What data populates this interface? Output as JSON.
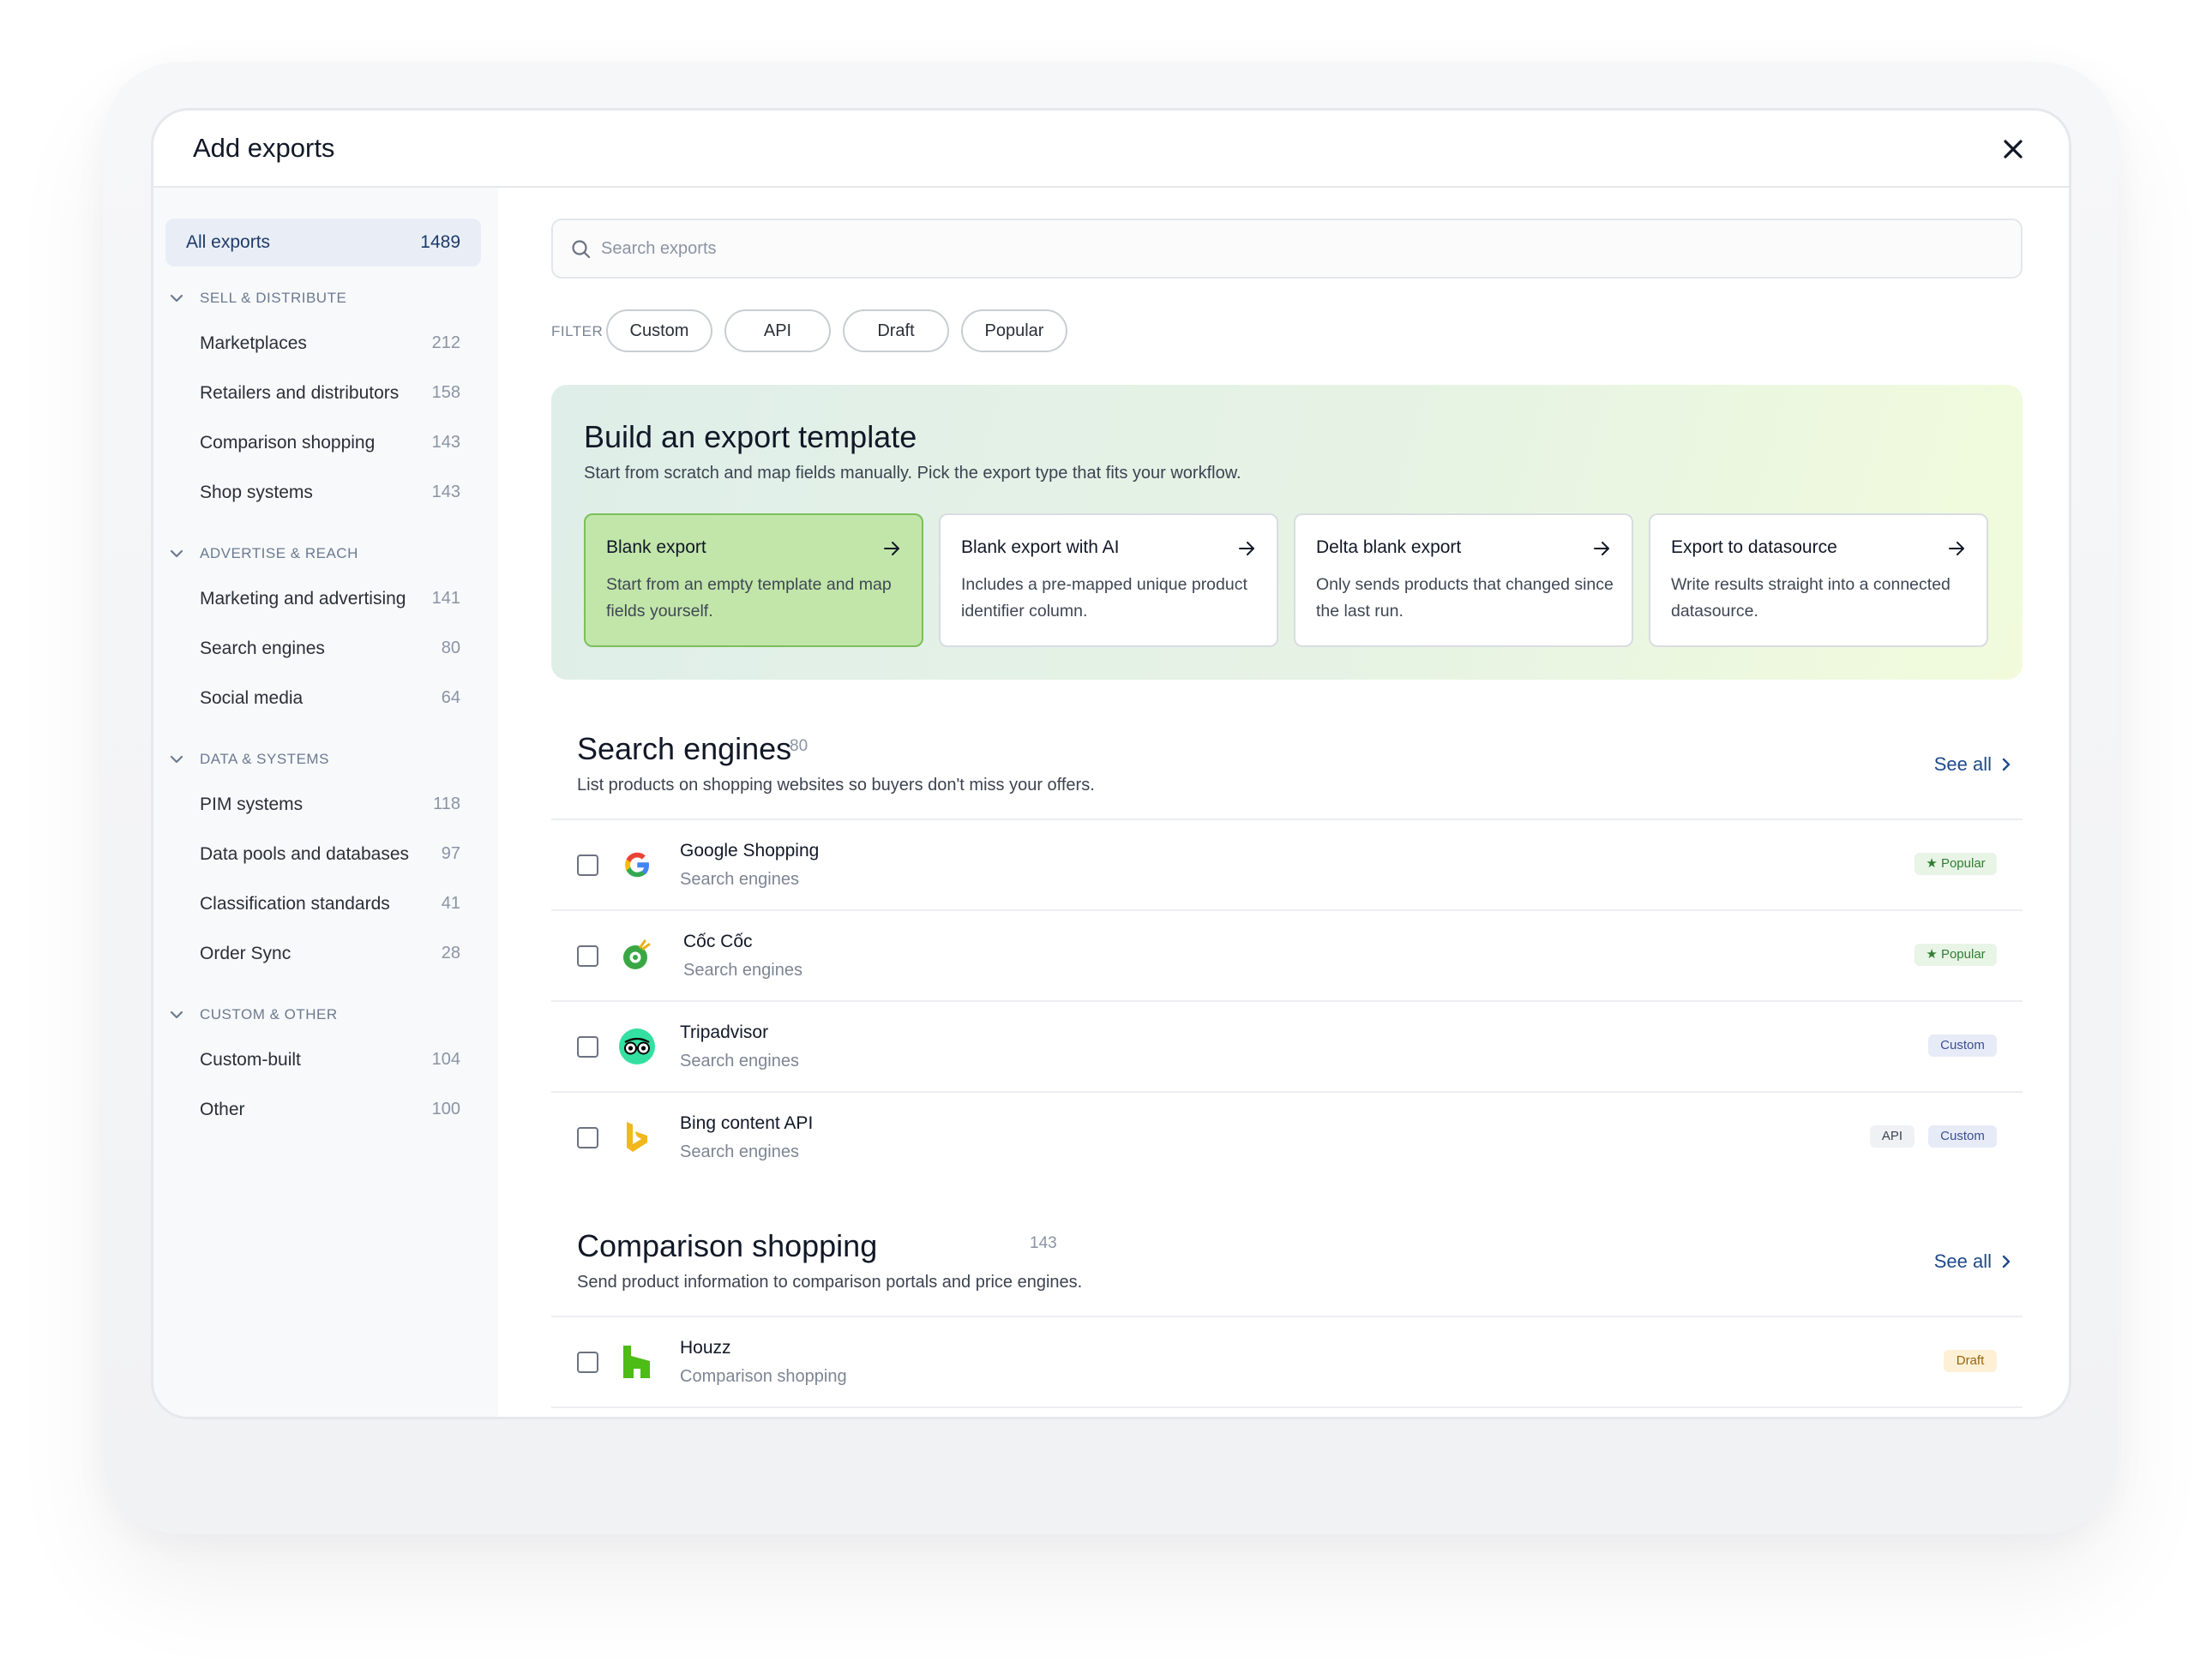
{
  "modal": {
    "title": "Add exports"
  },
  "sidebar": {
    "all": {
      "label": "All exports",
      "count": "1489"
    },
    "groups": [
      {
        "title": "SELL & DISTRIBUTE",
        "items": [
          {
            "label": "Marketplaces",
            "count": "212"
          },
          {
            "label": "Retailers and distributors",
            "count": "158"
          },
          {
            "label": "Comparison shopping",
            "count": "143"
          },
          {
            "label": "Shop systems",
            "count": "143"
          }
        ]
      },
      {
        "title": "ADVERTISE & REACH",
        "items": [
          {
            "label": "Marketing and advertising",
            "count": "141"
          },
          {
            "label": "Search engines",
            "count": "80"
          },
          {
            "label": "Social media",
            "count": "64"
          }
        ]
      },
      {
        "title": "DATA & SYSTEMS",
        "items": [
          {
            "label": "PIM systems",
            "count": "118"
          },
          {
            "label": "Data pools and databases",
            "count": "97"
          },
          {
            "label": "Classification standards",
            "count": "41"
          },
          {
            "label": "Order Sync",
            "count": "28"
          }
        ]
      },
      {
        "title": "CUSTOM & OTHER",
        "items": [
          {
            "label": "Custom-built",
            "count": "104"
          },
          {
            "label": "Other",
            "count": "100"
          }
        ]
      }
    ]
  },
  "search": {
    "placeholder": "Search exports",
    "icon": "search-icon"
  },
  "filters": {
    "label": "FILTER BY",
    "chips": [
      "Custom",
      "API",
      "Draft",
      "Popular"
    ]
  },
  "template": {
    "title": "Build an export template",
    "subtitle": "Start from scratch and map fields manually. Pick the export type that fits your workflow.",
    "cards": [
      {
        "title": "Blank export",
        "desc": "Start from an empty template and map fields yourself."
      },
      {
        "title": "Blank export with AI",
        "desc": "Includes a pre-mapped unique product identifier column."
      },
      {
        "title": "Delta blank export",
        "desc": "Only sends products that changed since the last run."
      },
      {
        "title": "Export to datasource",
        "desc": "Write results straight into a connected datasource."
      }
    ]
  },
  "sections": [
    {
      "title": "Search engines",
      "count": "80",
      "subtitle": "List products on shopping websites so buyers don't miss your offers.",
      "see_all": "See all",
      "rows": [
        {
          "name": "Google Shopping",
          "category": "Search engines",
          "logo": "google-logo",
          "badges": [
            "Popular"
          ]
        },
        {
          "name": "Cốc Cốc",
          "category": "Search engines",
          "logo": "coccoc-logo",
          "badges": [
            "Popular"
          ]
        },
        {
          "name": "Tripadvisor",
          "category": "Search engines",
          "logo": "tripadvisor-logo",
          "badges": [
            "Custom"
          ]
        },
        {
          "name": "Bing content API",
          "category": "Search engines",
          "logo": "bing-logo",
          "badges": [
            "API",
            "Custom"
          ]
        }
      ]
    },
    {
      "title": "Comparison shopping",
      "count": "143",
      "subtitle": "Send product information to comparison portals and price engines.",
      "see_all": "See all",
      "rows": [
        {
          "name": "Houzz",
          "category": "Comparison shopping",
          "logo": "houzz-logo",
          "badges": [
            "Draft"
          ]
        }
      ]
    }
  ],
  "colors": {
    "accent": "#1e4a8a",
    "active_card": "#c2e6aa",
    "popular": "#2f7d32"
  }
}
